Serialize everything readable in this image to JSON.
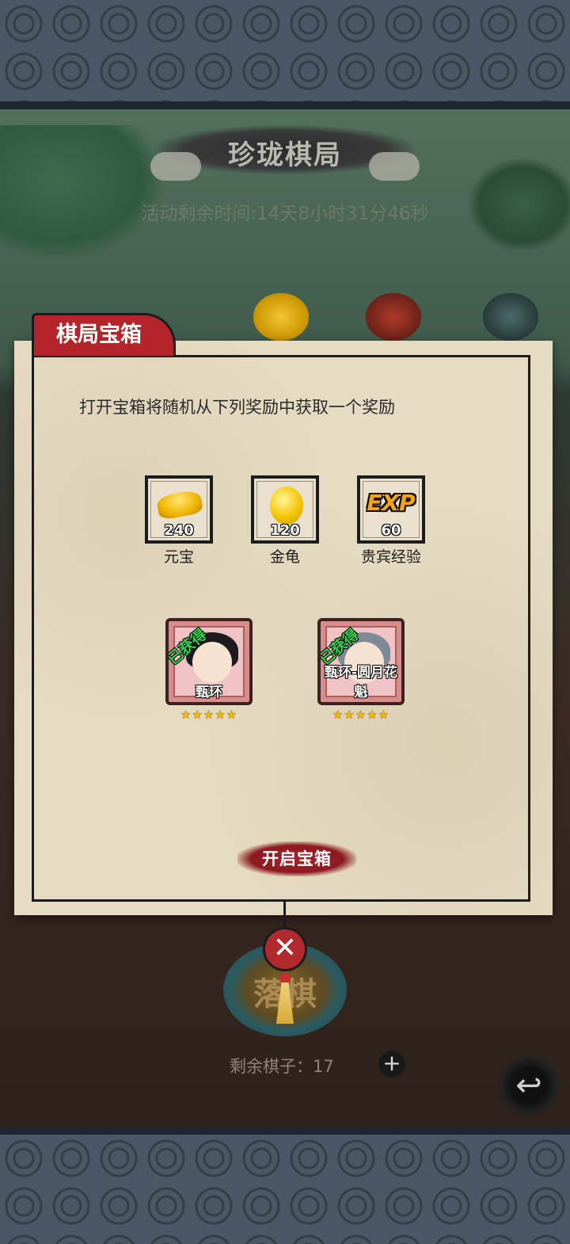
{
  "header": {
    "title": "珍珑棋局",
    "timer": "活动剩余时间:14天8小时31分46秒"
  },
  "modal": {
    "tab_label": "棋局宝箱",
    "description": "打开宝箱将随机从下列奖励中获取一个奖励",
    "rewards": [
      {
        "name": "元宝",
        "quantity": "240",
        "icon": "gold-ingot-icon"
      },
      {
        "name": "金龟",
        "quantity": "120",
        "icon": "golden-turtle-icon"
      },
      {
        "name": "贵宾经验",
        "quantity": "60",
        "icon": "exp-icon",
        "icon_text": "EXP"
      }
    ],
    "heroes": [
      {
        "name": "甄环",
        "status": "已获得",
        "stars": "★★★★★"
      },
      {
        "name": "甄环-圆月花魁",
        "status": "已获得",
        "stars": "★★★★★"
      }
    ],
    "open_button": "开启宝箱",
    "close_symbol": "✕"
  },
  "footer": {
    "drop_button": "落棋",
    "remaining_pieces": "剩余棋子：17",
    "plus_symbol": "+",
    "back_symbol": "↩"
  },
  "colors": {
    "accent_red": "#b3252a",
    "paper": "#e6dcc4",
    "obtained_green": "#2fd64a",
    "star_gold": "#f5b800"
  }
}
